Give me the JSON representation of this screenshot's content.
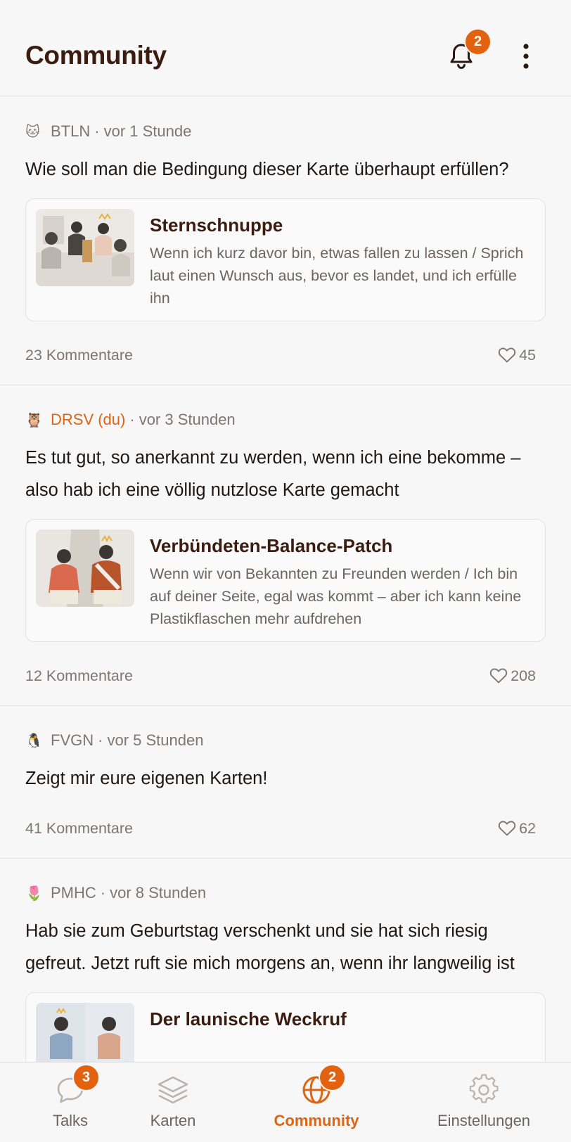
{
  "header": {
    "title": "Community",
    "notification_count": "2"
  },
  "posts": [
    {
      "emoji": "🐱",
      "author": "BTLN",
      "time": "vor 1 Stunde",
      "text": "Wie soll man die Bedingung dieser Karte überhaupt erfüllen?",
      "card": {
        "title": "Sternschnuppe",
        "desc": "Wenn ich kurz davor bin, etwas fallen zu lassen / Sprich laut einen Wunsch aus, bevor es landet, und ich erfülle ihn"
      },
      "comments": "23 Kommentare",
      "likes": "45"
    },
    {
      "emoji": "🦉",
      "author": "DRSV (du)",
      "time": "vor 3 Stunden",
      "text": "Es tut gut, so anerkannt zu werden, wenn ich eine bekomme – also hab ich eine völlig nutzlose Karte gemacht",
      "card": {
        "title": "Verbündeten-Balance-Patch",
        "desc": "Wenn wir von Bekannten zu Freunden werden / Ich bin auf deiner Seite, egal was kommt – aber ich kann keine Plastikflaschen mehr aufdrehen"
      },
      "comments": "12 Kommentare",
      "likes": "208"
    },
    {
      "emoji": "🐧",
      "author": "FVGN",
      "time": "vor 5 Stunden",
      "text": "Zeigt mir eure eigenen Karten!",
      "comments": "41 Kommentare",
      "likes": "62"
    },
    {
      "emoji": "🌷",
      "author": "PMHC",
      "time": "vor 8 Stunden",
      "text": "Hab sie zum Geburtstag verschenkt und sie hat sich riesig gefreut. Jetzt ruft sie mich morgens an, wenn ihr langweilig ist",
      "card": {
        "title": "Der launische Weckruf"
      }
    }
  ],
  "tabs": [
    {
      "label": "Talks",
      "badge": "3",
      "icon": "chat-bubble-icon"
    },
    {
      "label": "Karten",
      "icon": "layers-icon"
    },
    {
      "label": "Community",
      "badge": "2",
      "icon": "globe-icon",
      "active": true
    },
    {
      "label": "Einstellungen",
      "icon": "gear-icon"
    }
  ],
  "colors": {
    "accent": "#DD6412",
    "brand_dark": "#3A1C10",
    "muted": "#7D7672"
  }
}
